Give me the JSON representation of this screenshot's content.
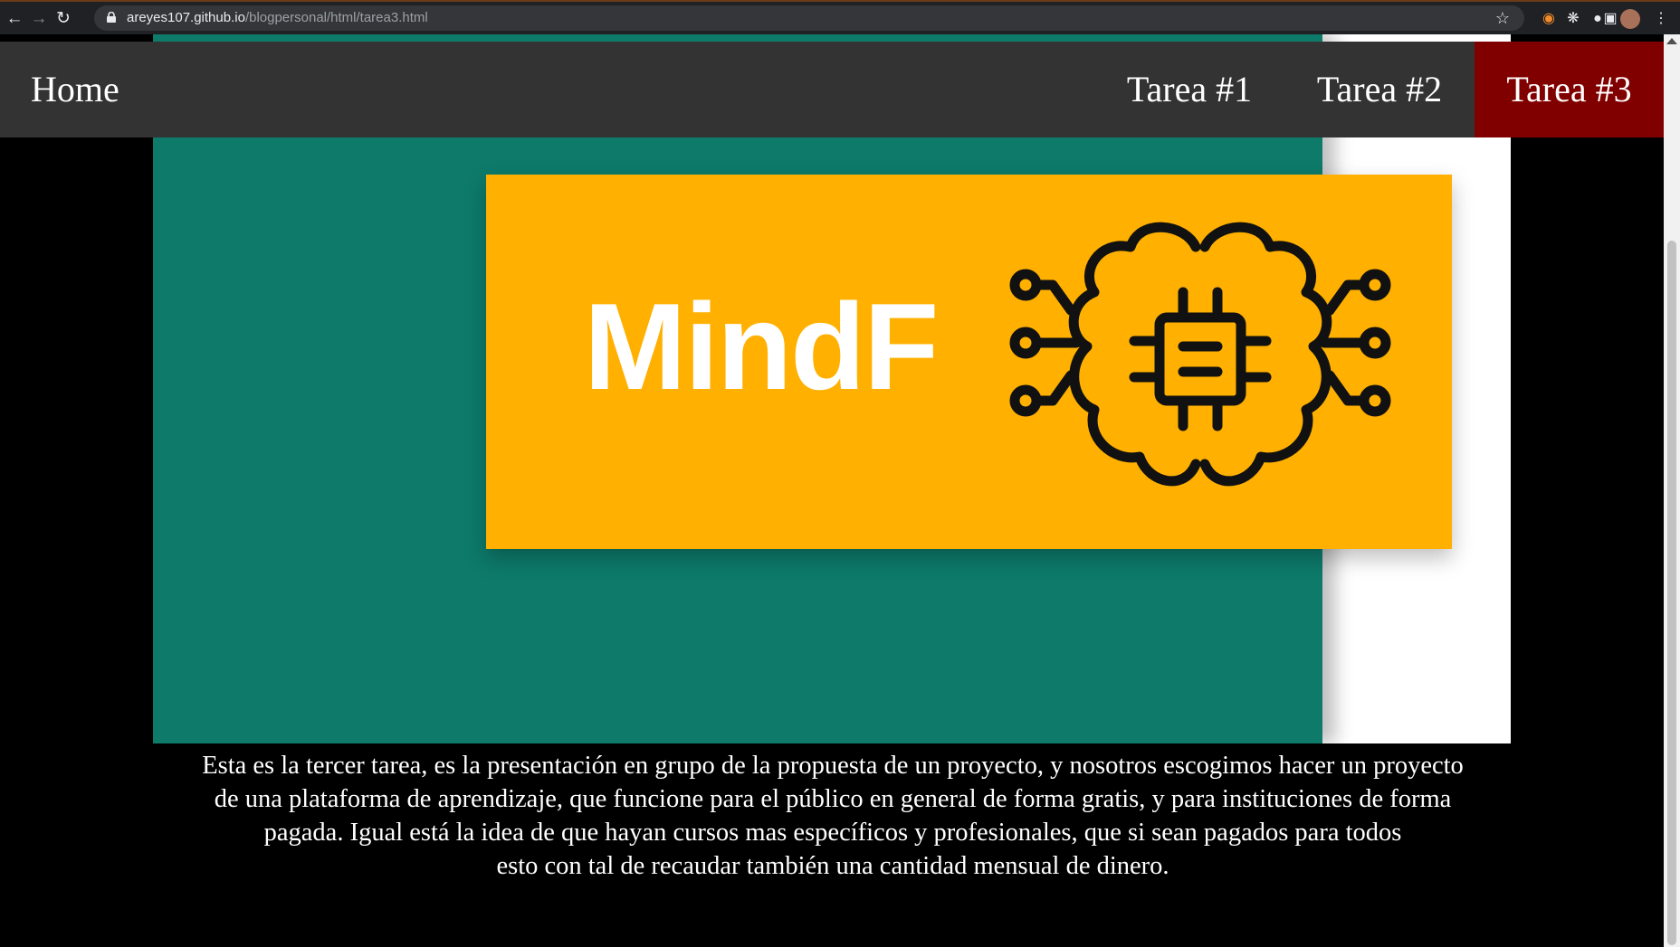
{
  "browser": {
    "url_host": "areyes107.github.io",
    "url_path": "/blogpersonal/html/tarea3.html",
    "icons": [
      "back-arrow-icon",
      "forward-arrow-icon",
      "reload-icon",
      "lock-icon",
      "star-icon",
      "extension-fox-icon",
      "extension-react-icon",
      "github-icon",
      "puzzle-icon",
      "menu-dots-icon"
    ]
  },
  "nav": {
    "home": "Home",
    "items": [
      {
        "label": "Tarea #1"
      },
      {
        "label": "Tarea #2"
      },
      {
        "label": "Tarea #3",
        "active": true
      }
    ],
    "active_color": "#800000"
  },
  "slide": {
    "logo_text": "MindF",
    "teal_color": "#0d7a6a",
    "card_color": "#ffb000",
    "logo_icon": "brain-circuit-icon"
  },
  "description": {
    "lines": [
      "Esta es la tercer tarea, es la presentación en grupo de la propuesta de un proyecto, y nosotros escogimos hacer un proyecto",
      "de una plataforma de aprendizaje, que funcione para el público en general de forma gratis, y para instituciones de forma",
      "pagada. Igual está la idea de que hayan cursos mas específicos y profesionales, que si sean pagados para todos",
      "esto con tal de recaudar también una cantidad mensual de dinero."
    ]
  }
}
